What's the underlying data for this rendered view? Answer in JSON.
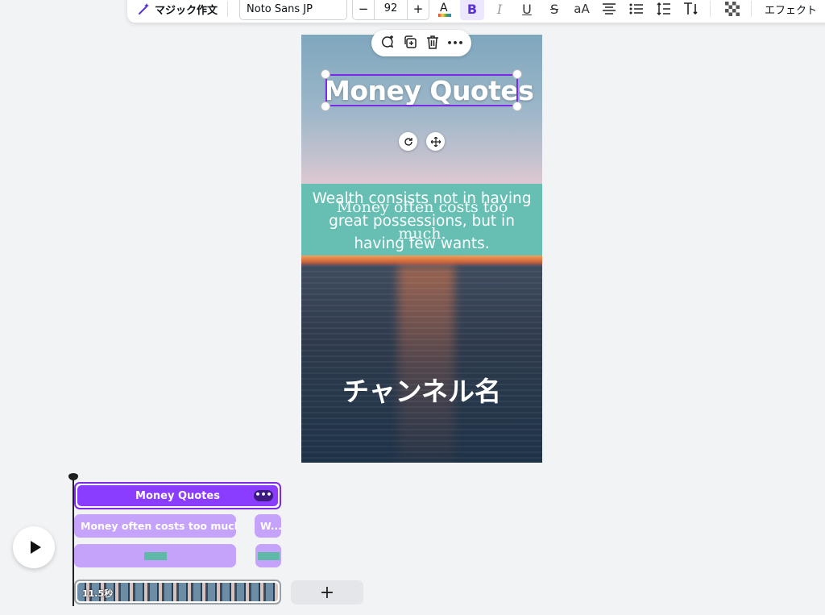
{
  "toolbar": {
    "magic_write_label": "マジック作文",
    "font_name": "Noto Sans JP",
    "decrease_label": "−",
    "font_size": "92",
    "increase_label": "+",
    "bold_label": "B",
    "italic_label": "I",
    "underline_label": "U",
    "strike_label": "S",
    "case_label": "aA",
    "effects_label": "エフェクト",
    "text_color": "#0d1216",
    "accent": "#7d2ae8"
  },
  "canvas": {
    "title": "Money Quotes",
    "quote_serif": "Money often costs too much.",
    "quote_sans": "Wealth consists not in having great possessions, but in having few wants.",
    "channel_name": "チャンネル名"
  },
  "float_toolbar": {
    "icons": [
      "comment-add-icon",
      "duplicate-icon",
      "trash-icon",
      "more-icon"
    ],
    "more_label": "•••"
  },
  "timeline": {
    "title_clip_label": "Money Quotes",
    "title_clip_more": "•••",
    "quote_clip_1_label": "Money often costs too much.",
    "quote_clip_2_label": "W...",
    "video_duration": "11.5秒",
    "add_label": "+",
    "clip_color": "#c6a3fb",
    "selected_color": "#8b3dff",
    "shape_color": "#5fb9a8"
  }
}
